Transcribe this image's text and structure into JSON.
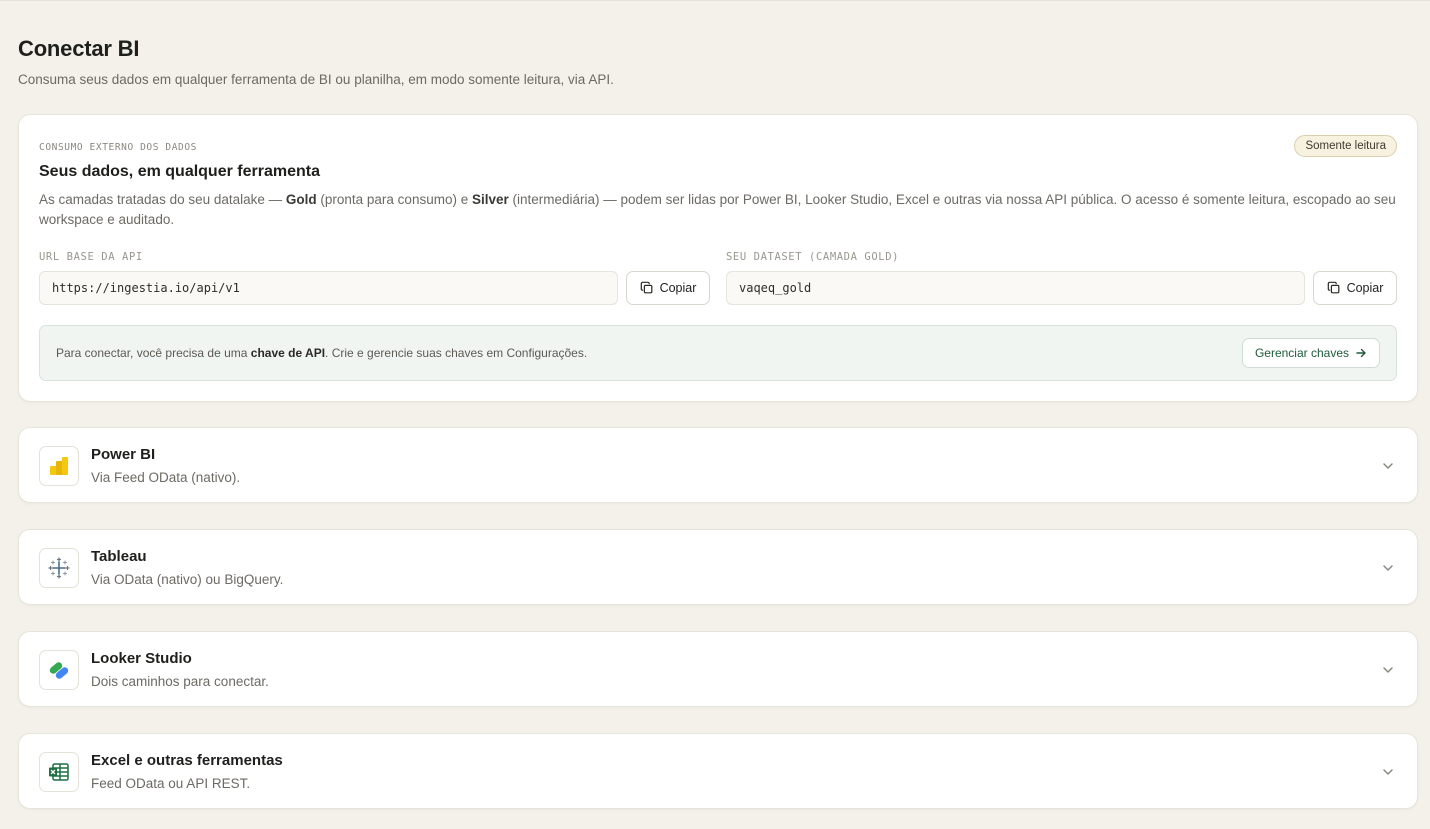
{
  "header": {
    "title": "Conectar BI",
    "subtitle": "Consuma seus dados em qualquer ferramenta de BI ou planilha, em modo somente leitura, via API."
  },
  "main_card": {
    "eyebrow": "CONSUMO EXTERNO DOS DADOS",
    "badge": "Somente leitura",
    "title": "Seus dados, em qualquer ferramenta",
    "desc_part1": "As camadas tratadas do seu datalake — ",
    "desc_gold": "Gold",
    "desc_part2": " (pronta para consumo) e ",
    "desc_silver": "Silver",
    "desc_part3": " (intermediária) — podem ser lidas por Power BI, Looker Studio, Excel e outras via nossa API pública. O acesso é somente leitura, escopado ao seu workspace e auditado.",
    "api_url_label": "URL BASE DA API",
    "api_url_value": "https://ingestia.io/api/v1",
    "dataset_label": "SEU DATASET (CAMADA GOLD)",
    "dataset_value": "vaqeq_gold",
    "copy_label": "Copiar",
    "info_part1": "Para conectar, você precisa de uma ",
    "info_bold": "chave de API",
    "info_part2": ". Crie e gerencie suas chaves em Configurações.",
    "manage_label": "Gerenciar chaves"
  },
  "tools": [
    {
      "name": "Power BI",
      "sub": "Via Feed OData (nativo).",
      "icon": "powerbi-icon"
    },
    {
      "name": "Tableau",
      "sub": "Via OData (nativo) ou BigQuery.",
      "icon": "tableau-icon"
    },
    {
      "name": "Looker Studio",
      "sub": "Dois caminhos para conectar.",
      "icon": "looker-studio-icon"
    },
    {
      "name": "Excel e outras ferramentas",
      "sub": "Feed OData ou API REST.",
      "icon": "excel-icon"
    }
  ],
  "colors": {
    "background": "#f3f1e9",
    "accent_green": "#1e5a3b",
    "powerbi_yellow": "#f2c811",
    "excel_green": "#1d6f42"
  }
}
